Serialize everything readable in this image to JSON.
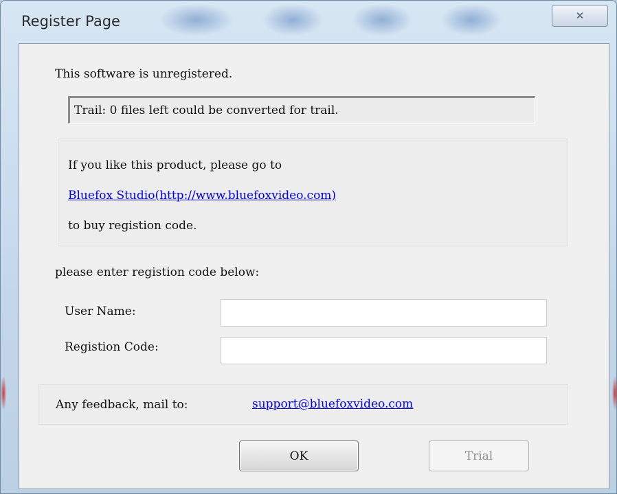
{
  "window": {
    "title": "Register Page",
    "close_icon": "close-icon",
    "close_glyph": "✕"
  },
  "status": {
    "heading": "This software is unregistered.",
    "trial_message": "Trail: 0 files left could be converted for trail."
  },
  "purchase": {
    "line1": "If you like this product, please go to",
    "link_text": "Bluefox Studio(http://www.bluefoxvideo.com)",
    "line3": "to buy registion code."
  },
  "registration": {
    "prompt": "please enter registion code below:",
    "user_name_label": "User Name:",
    "user_name_value": "",
    "code_label": "Registion Code:",
    "code_value": ""
  },
  "feedback": {
    "label": "Any feedback, mail to:",
    "email": "support@bluefoxvideo.com"
  },
  "buttons": {
    "ok": "OK",
    "trial": "Trial"
  },
  "colors": {
    "link": "#0000ee",
    "dialog_bg": "#f0f0f0",
    "frame": "#c4d7ea"
  }
}
